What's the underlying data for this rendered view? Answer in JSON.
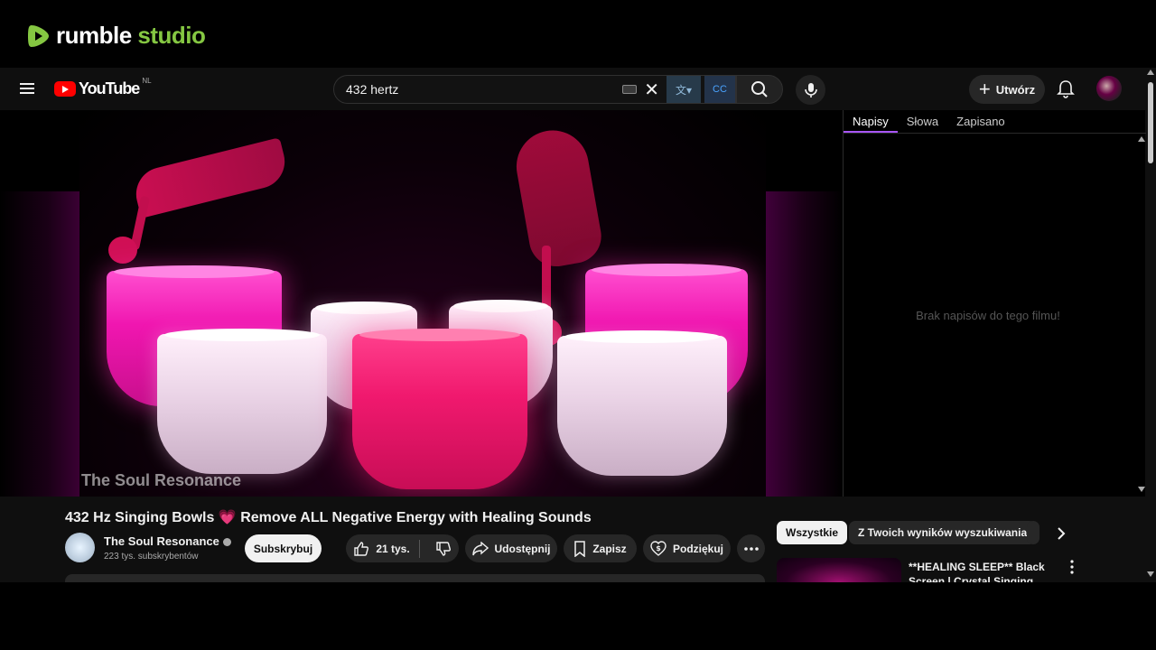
{
  "rumble": {
    "brand_main": "rumble",
    "brand_accent": "studio",
    "accent_color": "#85c742"
  },
  "youtube": {
    "logo_text": "YouTube",
    "country_code": "NL",
    "search": {
      "query": "432 hertz"
    },
    "create_label": "Utwórz",
    "accent_red": "#ff0000"
  },
  "player": {
    "watermark": "The Soul Resonance"
  },
  "transcript": {
    "tabs": [
      "Napisy",
      "Słowa",
      "Zapisano"
    ],
    "active_tab": "Napisy",
    "empty_message": "Brak napisów do tego filmu!"
  },
  "video": {
    "title_part1": "432 Hz Singing Bowls",
    "title_emoji": "💗",
    "title_part2": "Remove ALL Negative Energy with Healing Sounds",
    "channel": "The Soul Resonance",
    "subscribers": "223 tys. subskrybentów",
    "subscribe_label": "Subskrybuj",
    "likes": "21 tys.",
    "share_label": "Udostępnij",
    "save_label": "Zapisz",
    "thanks_label": "Podziękuj"
  },
  "related": {
    "chips": [
      "Wszystkie",
      "Z Twoich wyników wyszukiwania"
    ],
    "first_title": "**HEALING SLEEP** Black Screen | Crystal Singing Bowls"
  }
}
